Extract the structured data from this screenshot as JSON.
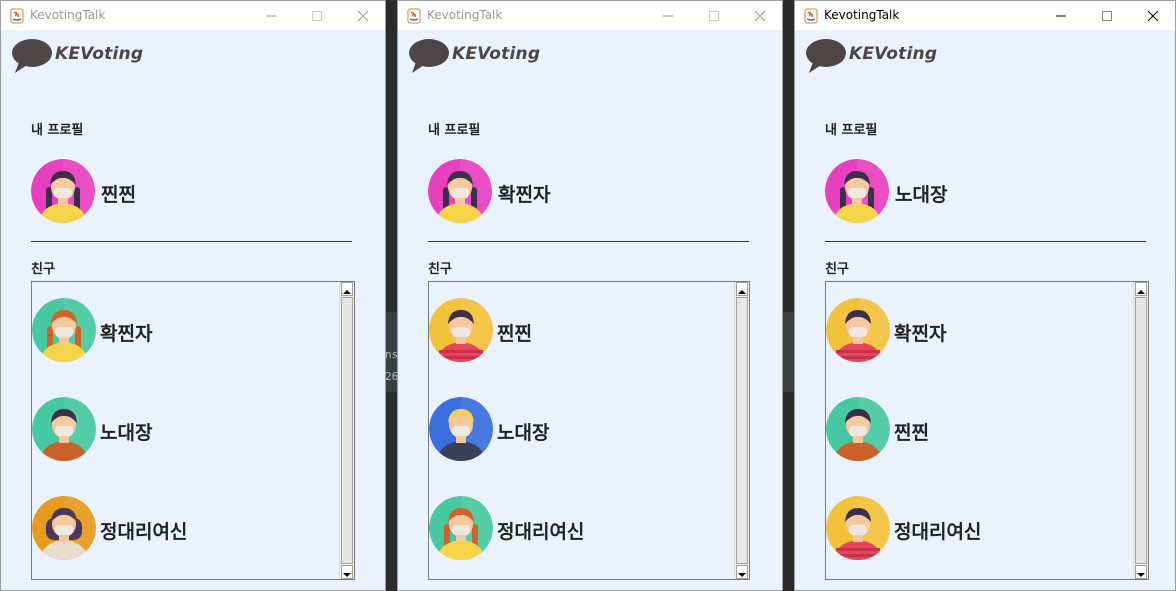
{
  "windows": [
    {
      "title": "KevotingTalk",
      "active": false,
      "logo_text": "KEVoting",
      "my_profile_label": "내 프로필",
      "my_name": "찐찐",
      "friends_label": "친구",
      "friends": [
        {
          "name": "확찐자",
          "avatar": "woman-braids-green-bg-icon"
        },
        {
          "name": "노대장",
          "avatar": "man-suit-green-bg-icon"
        },
        {
          "name": "정대리여신",
          "avatar": "woman-bob-orange-bg-icon"
        }
      ]
    },
    {
      "title": "KevotingTalk",
      "active": false,
      "logo_text": "KEVoting",
      "my_profile_label": "내 프로필",
      "my_name": "확찐자",
      "friends_label": "친구",
      "friends": [
        {
          "name": "찐찐",
          "avatar": "man-striped-yellow-bg-icon"
        },
        {
          "name": "노대장",
          "avatar": "man-blonde-blue-bg-icon"
        },
        {
          "name": "정대리여신",
          "avatar": "woman-braids-green-bg-icon"
        }
      ]
    },
    {
      "title": "KevotingTalk",
      "active": true,
      "logo_text": "KEVoting",
      "my_profile_label": "내 프로필",
      "my_name": "노대장",
      "friends_label": "친구",
      "friends": [
        {
          "name": "확찐자",
          "avatar": "man-striped-yellow-bg-icon"
        },
        {
          "name": "찐찐",
          "avatar": "man-suit-green-bg-icon"
        },
        {
          "name": "정대리여신",
          "avatar": "man-striped-yellow-bg-icon"
        }
      ]
    }
  ],
  "background_fragments": [
    "ns",
    "26"
  ],
  "colors": {
    "window_bg": "#eaf2fd",
    "my_avatar_bg": "#e83fbf",
    "green_bg": "#46c9a0",
    "yellow_bg": "#f2c23a",
    "blue_bg": "#3a6fe0",
    "orange_bg": "#e89a1c"
  }
}
